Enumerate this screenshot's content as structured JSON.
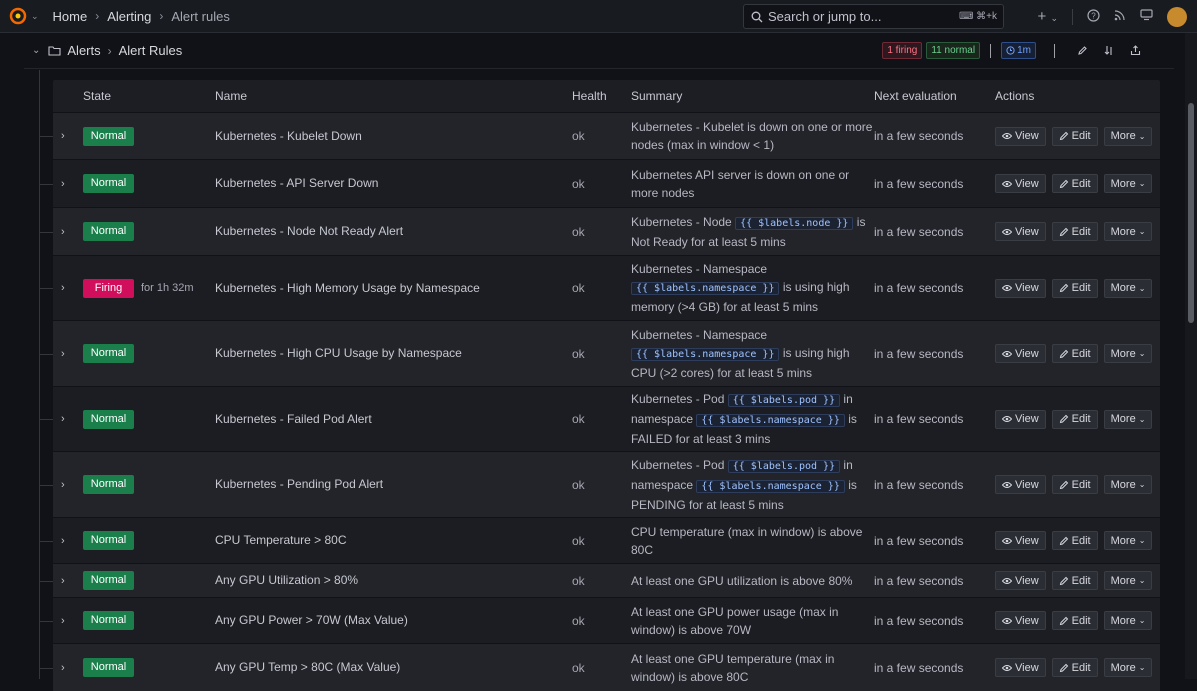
{
  "topbar": {
    "breadcrumb": [
      "Home",
      "Alerting",
      "Alert rules"
    ],
    "search_placeholder": "Search or jump to...",
    "search_shortcut": "⌘+k"
  },
  "folder_header": {
    "folder": "Alerts",
    "group": "Alert Rules",
    "firing_count": "1 firing",
    "normal_count": "11 normal",
    "interval": "1m"
  },
  "table": {
    "headers": [
      "State",
      "Name",
      "Health",
      "Summary",
      "Next evaluation",
      "Actions"
    ],
    "actions": {
      "view": "View",
      "edit": "Edit",
      "more": "More"
    },
    "rows": [
      {
        "state": "Normal",
        "duration": "",
        "name": "Kubernetes - Kubelet Down",
        "health": "ok",
        "summary": [
          [
            "t",
            "Kubernetes - Kubelet is down on one or more nodes (max in window < 1)"
          ]
        ],
        "next": "in a few seconds"
      },
      {
        "state": "Normal",
        "duration": "",
        "name": "Kubernetes - API Server Down",
        "health": "ok",
        "summary": [
          [
            "t",
            "Kubernetes API server is down on one or more nodes"
          ]
        ],
        "next": "in a few seconds"
      },
      {
        "state": "Normal",
        "duration": "",
        "name": "Kubernetes - Node Not Ready Alert",
        "health": "ok",
        "summary": [
          [
            "t",
            "Kubernetes - Node "
          ],
          [
            "c",
            "{{ $labels.node }}"
          ],
          [
            "t",
            " is Not Ready for at least 5 mins"
          ]
        ],
        "next": "in a few seconds"
      },
      {
        "state": "Firing",
        "duration": "for 1h 32m",
        "name": "Kubernetes - High Memory Usage by Namespace",
        "health": "ok",
        "summary": [
          [
            "t",
            "Kubernetes - Namespace "
          ],
          [
            "c",
            "{{ $labels.namespace }}"
          ],
          [
            "t",
            " is using high memory (>4 GB) for at least 5 mins"
          ]
        ],
        "next": "in a few seconds"
      },
      {
        "state": "Normal",
        "duration": "",
        "name": "Kubernetes - High CPU Usage by Namespace",
        "health": "ok",
        "summary": [
          [
            "t",
            "Kubernetes - Namespace "
          ],
          [
            "c",
            "{{ $labels.namespace }}"
          ],
          [
            "t",
            " is using high CPU (>2 cores) for at least 5 mins"
          ]
        ],
        "next": "in a few seconds"
      },
      {
        "state": "Normal",
        "duration": "",
        "name": "Kubernetes - Failed Pod Alert",
        "health": "ok",
        "summary": [
          [
            "t",
            "Kubernetes - Pod "
          ],
          [
            "c",
            "{{ $labels.pod }}"
          ],
          [
            "t",
            " in namespace "
          ],
          [
            "c",
            "{{ $labels.namespace }}"
          ],
          [
            "t",
            " is FAILED for at least 3 mins"
          ]
        ],
        "next": "in a few seconds"
      },
      {
        "state": "Normal",
        "duration": "",
        "name": "Kubernetes - Pending Pod Alert",
        "health": "ok",
        "summary": [
          [
            "t",
            "Kubernetes - Pod "
          ],
          [
            "c",
            "{{ $labels.pod }}"
          ],
          [
            "t",
            " in namespace "
          ],
          [
            "c",
            "{{ $labels.namespace }}"
          ],
          [
            "t",
            " is PENDING for at least 5 mins"
          ]
        ],
        "next": "in a few seconds"
      },
      {
        "state": "Normal",
        "duration": "",
        "name": "CPU Temperature > 80C",
        "health": "ok",
        "summary": [
          [
            "t",
            "CPU temperature (max in window) is above 80C"
          ]
        ],
        "next": "in a few seconds"
      },
      {
        "state": "Normal",
        "duration": "",
        "name": "Any GPU Utilization > 80%",
        "health": "ok",
        "summary": [
          [
            "t",
            "At least one GPU utilization is above 80%"
          ]
        ],
        "next": "in a few seconds"
      },
      {
        "state": "Normal",
        "duration": "",
        "name": "Any GPU Power > 70W (Max Value)",
        "health": "ok",
        "summary": [
          [
            "t",
            "At least one GPU power usage (max in window) is above 70W"
          ]
        ],
        "next": "in a few seconds"
      },
      {
        "state": "Normal",
        "duration": "",
        "name": "Any GPU Temp > 80C (Max Value)",
        "health": "ok",
        "summary": [
          [
            "t",
            "At least one GPU temperature (max in window) is above 80C"
          ]
        ],
        "next": "in a few seconds"
      }
    ]
  },
  "colors": {
    "normal": "#1a7f4b",
    "firing": "#d10e5c",
    "background": "#111217"
  },
  "icons": [
    "grafana-logo-icon",
    "chevron-right-icon",
    "search-icon",
    "keyboard-icon",
    "plus-icon",
    "help-icon",
    "rss-icon",
    "monitor-icon",
    "folder-icon",
    "clock-icon",
    "pencil-icon",
    "sort-icon",
    "export-icon",
    "eye-icon",
    "edit-icon",
    "chevron-down-icon"
  ]
}
